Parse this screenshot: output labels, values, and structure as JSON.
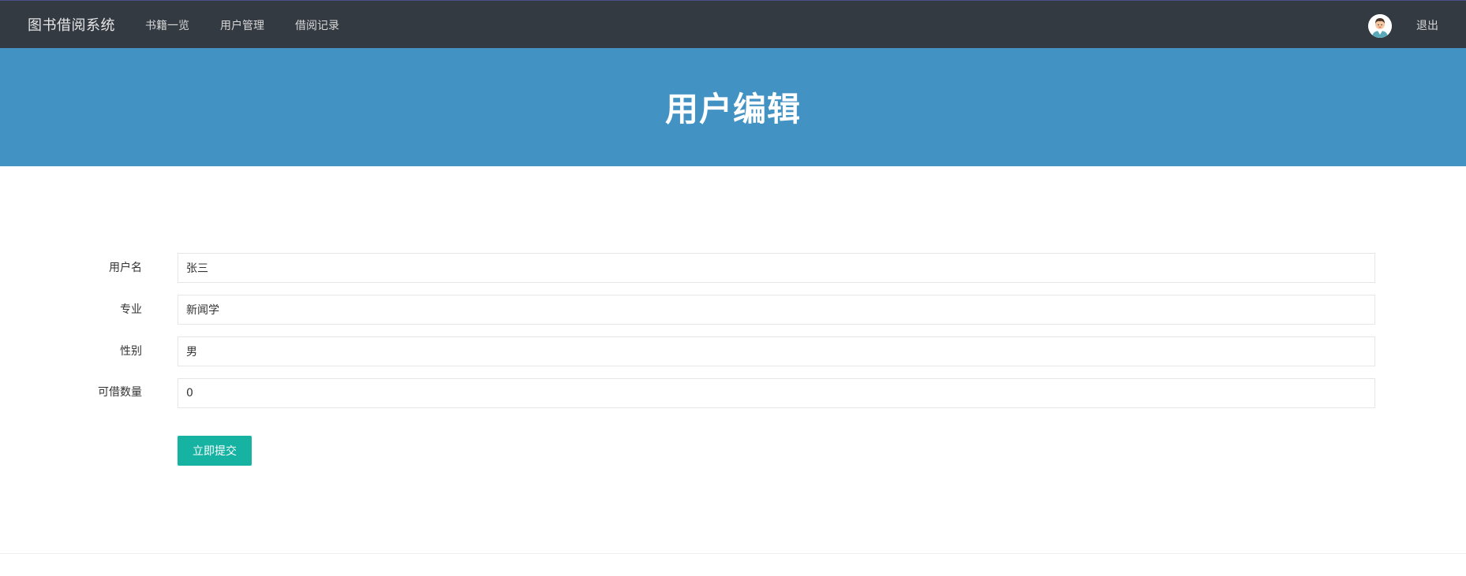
{
  "app": {
    "brand": "图书借阅系统"
  },
  "nav": {
    "items": [
      {
        "label": "书籍一览"
      },
      {
        "label": "用户管理"
      },
      {
        "label": "借阅记录"
      }
    ],
    "logout_label": "退出",
    "avatar_icon": "user-avatar-icon"
  },
  "banner": {
    "title": "用户编辑"
  },
  "form": {
    "fields": [
      {
        "label": "用户名",
        "value": "张三"
      },
      {
        "label": "专业",
        "value": "新闻学"
      },
      {
        "label": "性别",
        "value": "男"
      },
      {
        "label": "可借数量",
        "value": "0"
      }
    ],
    "submit_label": "立即提交"
  },
  "colors": {
    "topbar": "#333a42",
    "banner": "#4292c4",
    "submit": "#16b3a2"
  }
}
